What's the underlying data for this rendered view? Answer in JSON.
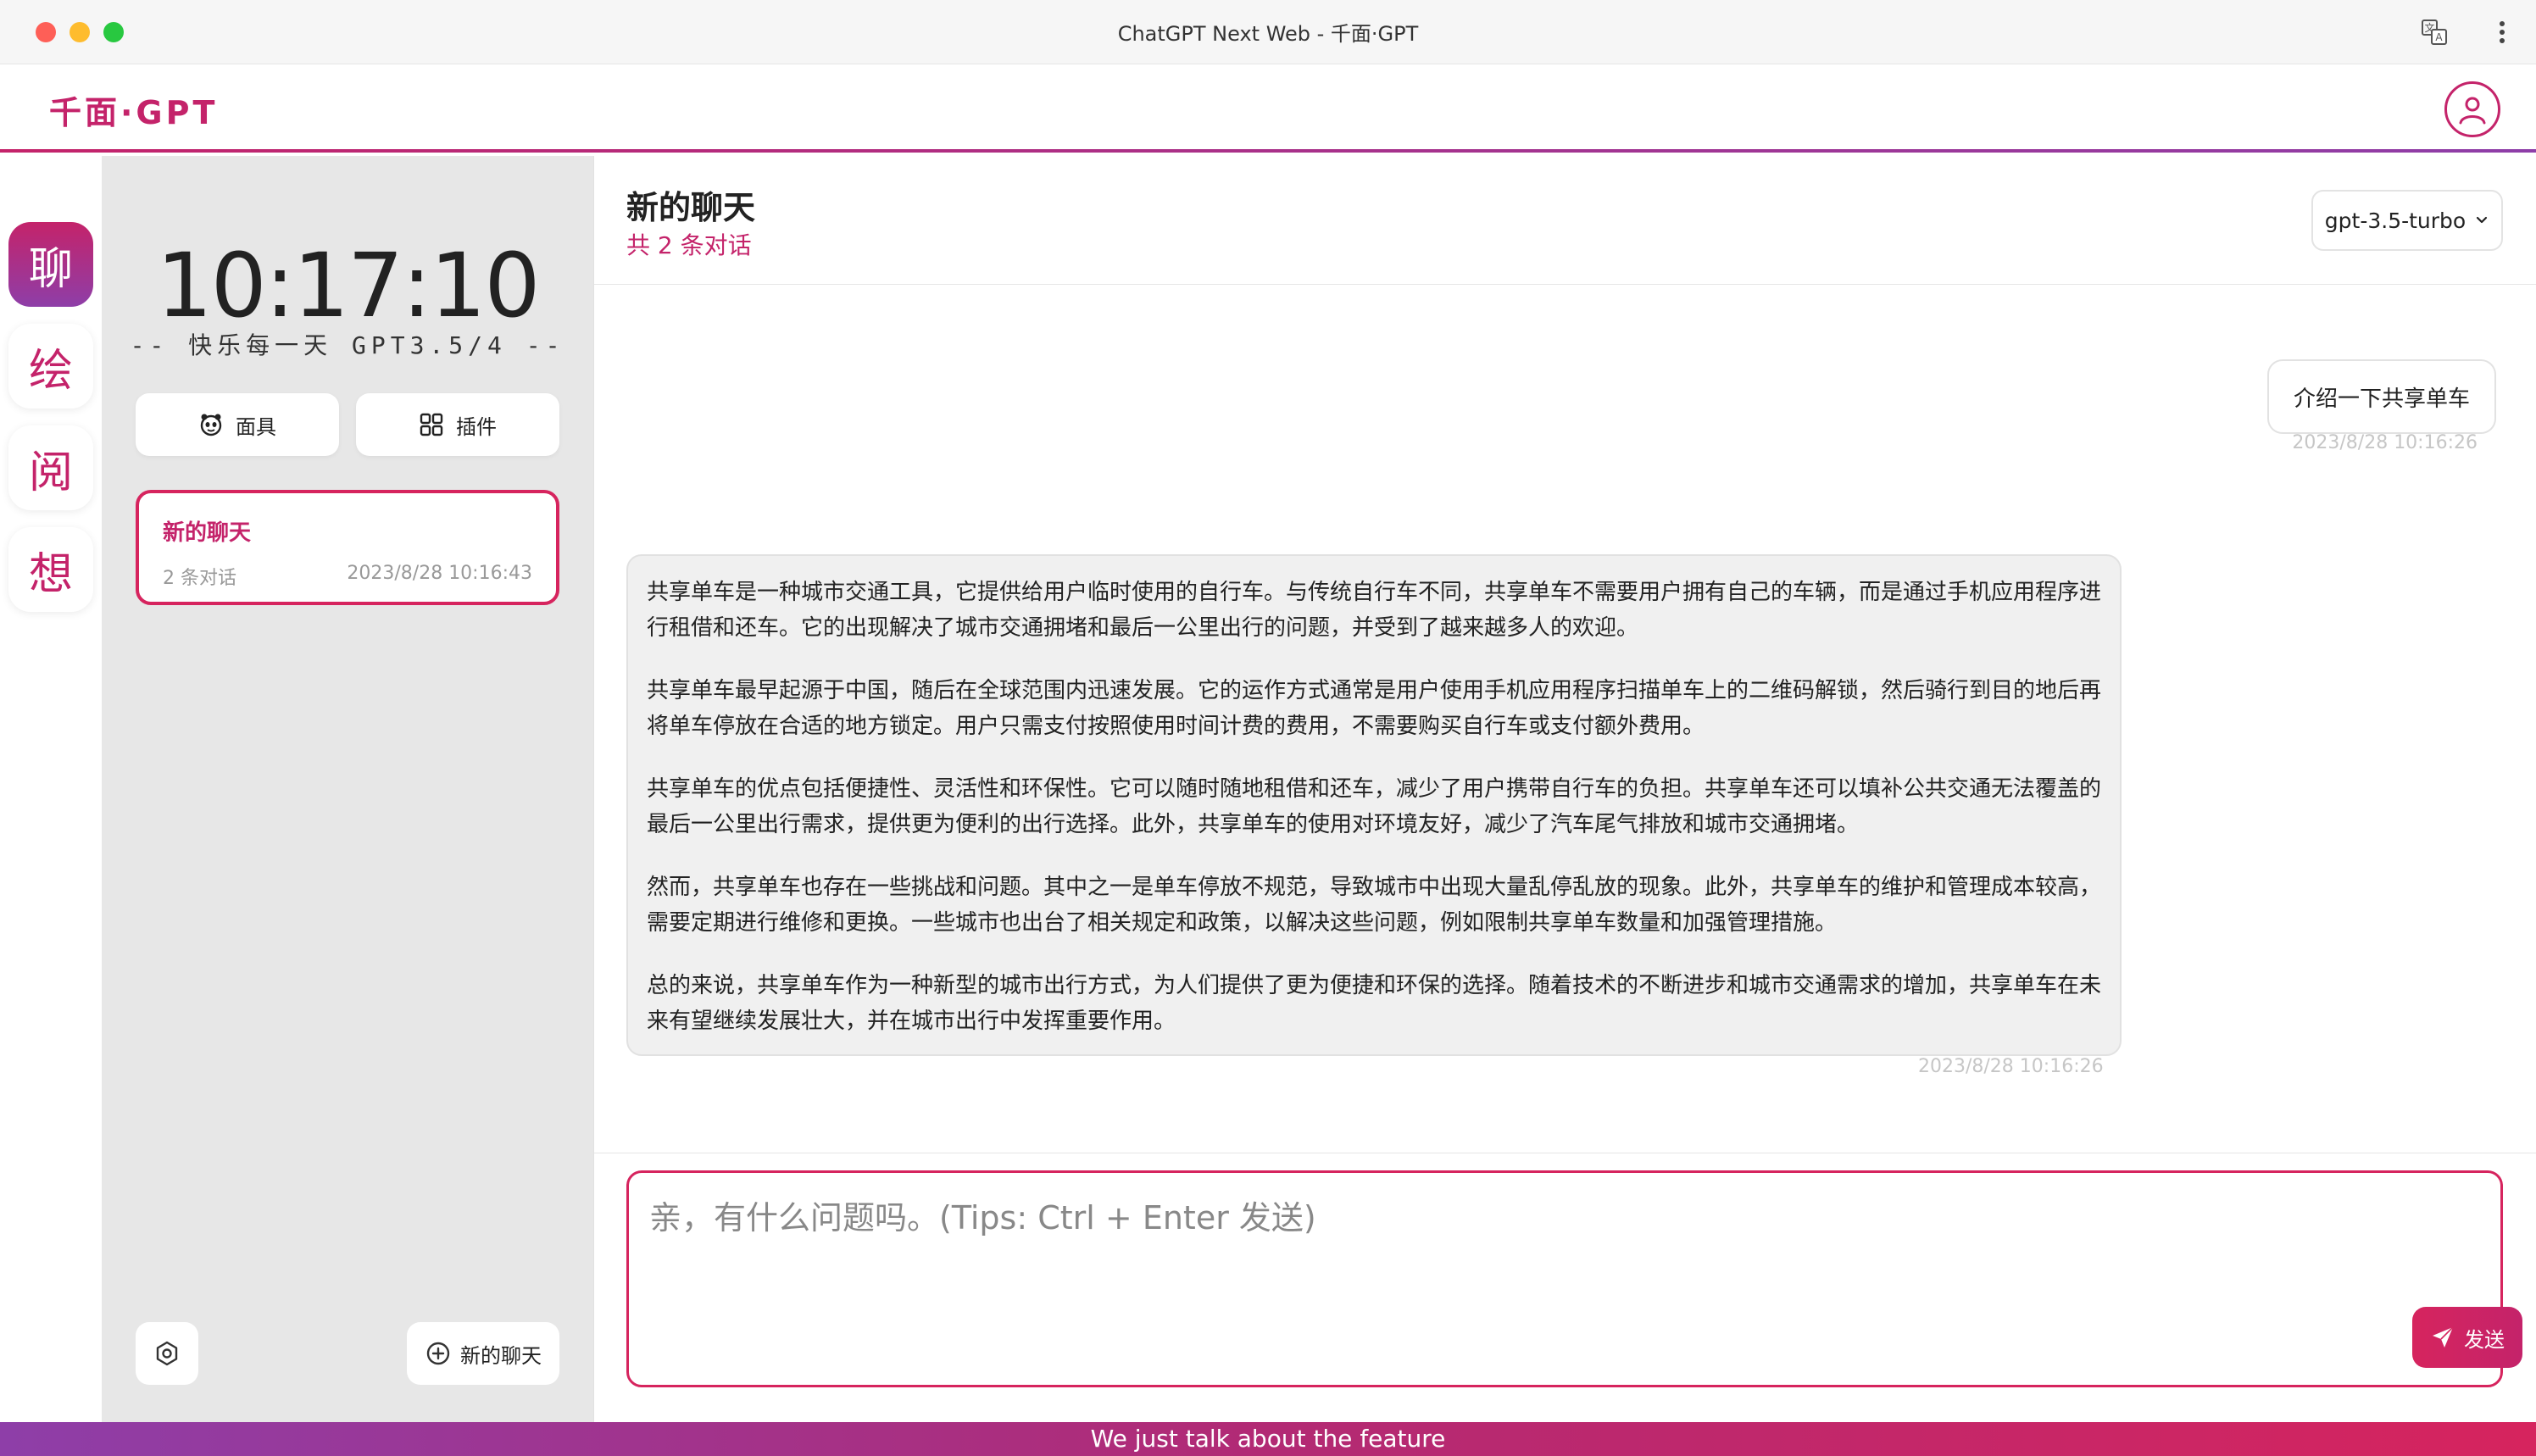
{
  "window": {
    "title": "ChatGPT Next Web - 千面·GPT"
  },
  "header": {
    "logo": "千面·GPT"
  },
  "rail": {
    "modes": [
      "聊",
      "绘",
      "阅",
      "想"
    ]
  },
  "sidebar": {
    "clock": "10:17:10",
    "subtitle": "-- 快乐每一天 GPT3.5/4 --",
    "mask_label": "面具",
    "plugin_label": "插件",
    "chat_item": {
      "title": "新的聊天",
      "count": "2 条对话",
      "time": "2023/8/28 10:16:43"
    },
    "new_chat_label": "新的聊天"
  },
  "main": {
    "title": "新的聊天",
    "subtitle": "共 2 条对话",
    "model": "gpt-3.5-turbo"
  },
  "messages": {
    "user": {
      "text": "介绍一下共享单车",
      "time": "2023/8/28 10:16:26"
    },
    "bot": {
      "paragraphs": [
        "共享单车是一种城市交通工具，它提供给用户临时使用的自行车。与传统自行车不同，共享单车不需要用户拥有自己的车辆，而是通过手机应用程序进行租借和还车。它的出现解决了城市交通拥堵和最后一公里出行的问题，并受到了越来越多人的欢迎。",
        "共享单车最早起源于中国，随后在全球范围内迅速发展。它的运作方式通常是用户使用手机应用程序扫描单车上的二维码解锁，然后骑行到目的地后再将单车停放在合适的地方锁定。用户只需支付按照使用时间计费的费用，不需要购买自行车或支付额外费用。",
        "共享单车的优点包括便捷性、灵活性和环保性。它可以随时随地租借和还车，减少了用户携带自行车的负担。共享单车还可以填补公共交通无法覆盖的最后一公里出行需求，提供更为便利的出行选择。此外，共享单车的使用对环境友好，减少了汽车尾气排放和城市交通拥堵。",
        "然而，共享单车也存在一些挑战和问题。其中之一是单车停放不规范，导致城市中出现大量乱停乱放的现象。此外，共享单车的维护和管理成本较高，需要定期进行维修和更换。一些城市也出台了相关规定和政策，以解决这些问题，例如限制共享单车数量和加强管理措施。",
        "总的来说，共享单车作为一种新型的城市出行方式，为人们提供了更为便捷和环保的选择。随着技术的不断进步和城市交通需求的增加，共享单车在未来有望继续发展壮大，并在城市出行中发挥重要作用。"
      ],
      "time": "2023/8/28 10:16:26"
    }
  },
  "input": {
    "placeholder": "亲，有什么问题吗。(Tips: Ctrl + Enter 发送)",
    "value": "",
    "send_label": "发送"
  },
  "banner": {
    "text": "We just talk about the feature"
  },
  "colors": {
    "accent": "#c4236a",
    "accent_alt": "#8e3ea8",
    "border_accent": "#d6245e"
  },
  "icons": [
    "translate-icon",
    "more-vertical-icon",
    "user-icon",
    "mask-icon",
    "plugin-grid-icon",
    "settings-icon",
    "plus-circle-icon",
    "chevron-down-icon",
    "send-icon"
  ]
}
